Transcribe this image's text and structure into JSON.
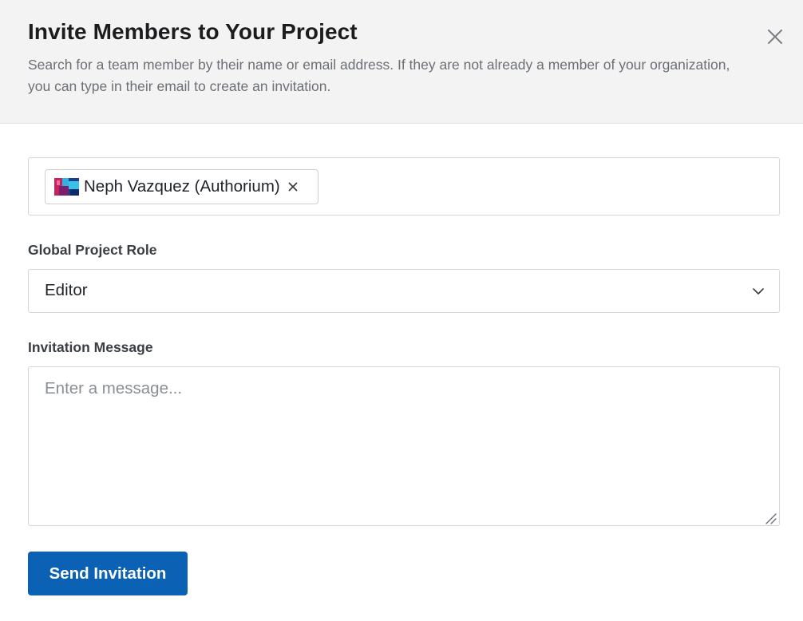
{
  "dialog": {
    "title": "Invite Members to Your Project",
    "description": "Search for a team member by their name or email address. If they are not already a member of your organization, you can type in their email to create an invitation.",
    "close_icon": "close-icon"
  },
  "members": {
    "selected": [
      {
        "label": "Neph Vazquez (Authorium)",
        "avatar_icon": "avatar-image",
        "remove_icon": "remove-x-icon"
      }
    ]
  },
  "role": {
    "label": "Global Project Role",
    "value": "Editor",
    "icon": "chevron-down-icon"
  },
  "message": {
    "label": "Invitation Message",
    "value": "",
    "placeholder": "Enter a message..."
  },
  "actions": {
    "send_label": "Send Invitation"
  },
  "colors": {
    "header_bg": "#f3f3f3",
    "primary_button": "#0b62b5"
  }
}
